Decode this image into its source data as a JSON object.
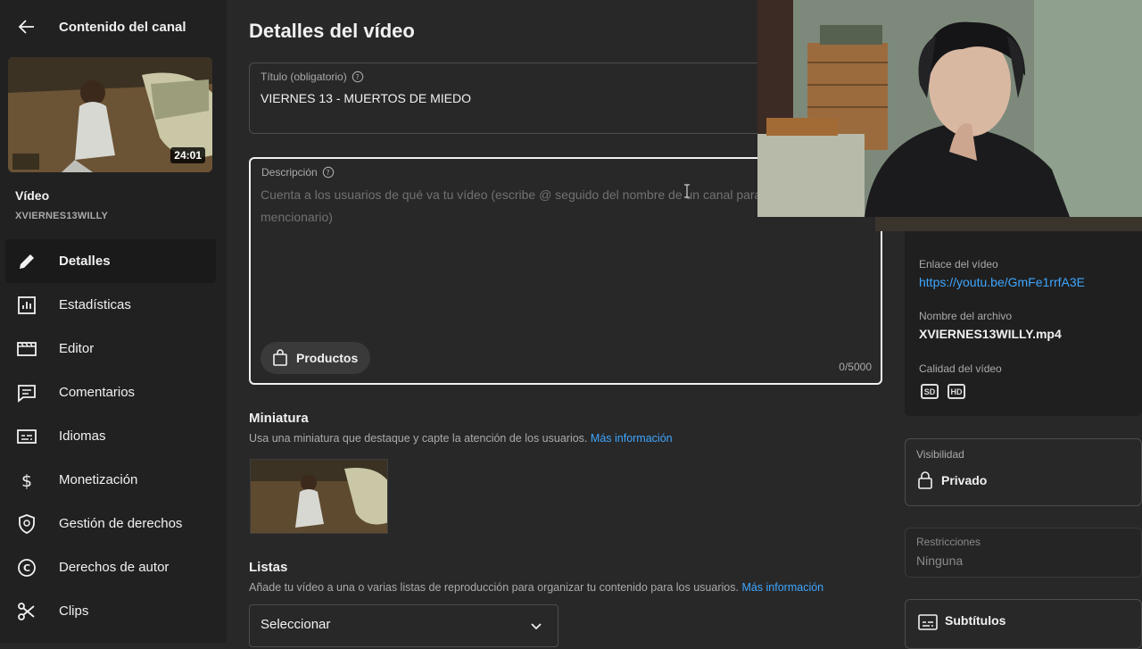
{
  "sidebar": {
    "back_title": "Contenido del canal",
    "thumbnail_duration": "24:01",
    "video_label": "Vídeo",
    "video_filename_short": "XVIERNES13WILLY",
    "items": [
      {
        "label": "Detalles",
        "icon": "pencil-icon",
        "active": true
      },
      {
        "label": "Estadísticas",
        "icon": "analytics-icon",
        "active": false
      },
      {
        "label": "Editor",
        "icon": "editor-icon",
        "active": false
      },
      {
        "label": "Comentarios",
        "icon": "comments-icon",
        "active": false
      },
      {
        "label": "Idiomas",
        "icon": "subtitles-icon",
        "active": false
      },
      {
        "label": "Monetización",
        "icon": "dollar-icon",
        "active": false
      },
      {
        "label": "Gestión de derechos",
        "icon": "rights-shield-icon",
        "active": false
      },
      {
        "label": "Derechos de autor",
        "icon": "copyright-icon",
        "active": false
      },
      {
        "label": "Clips",
        "icon": "scissors-icon",
        "active": false
      }
    ]
  },
  "main": {
    "page_title": "Detalles del vídeo",
    "title_field": {
      "label": "Título (obligatorio)",
      "value": "VIERNES 13 - MUERTOS DE MIEDO"
    },
    "description_field": {
      "label": "Descripción",
      "placeholder": "Cuenta a los usuarios de qué va tu vídeo (escribe @ seguido del nombre de un canal para mencionario)",
      "products_label": "Productos",
      "char_count": "0/5000"
    },
    "thumbnail_section": {
      "heading": "Miniatura",
      "text": "Usa una miniatura que destaque y capte la atención de los usuarios.",
      "link": "Más información"
    },
    "playlists_section": {
      "heading": "Listas",
      "text": "Añade tu vídeo a una o varias listas de reproducción para organizar tu contenido para los usuarios.",
      "link": "Más información",
      "select_value": "Seleccionar"
    }
  },
  "right_panel": {
    "link_label": "Enlace del vídeo",
    "link_value": "https://youtu.be/GmFe1rrfA3E",
    "file_label": "Nombre del archivo",
    "file_value": "XVIERNES13WILLY.mp4",
    "quality_label": "Calidad del vídeo",
    "quality_badges": [
      "SD",
      "HD"
    ],
    "visibility_label": "Visibilidad",
    "visibility_value": "Privado",
    "restrictions_label": "Restricciones",
    "restrictions_value": "Ninguna",
    "subtitles_label": "Subtítulos"
  },
  "colors": {
    "background": "#282828",
    "sidebar": "#212121",
    "link": "#3ea6ff",
    "text": "#f1f1f1",
    "muted": "#aaaaaa"
  }
}
